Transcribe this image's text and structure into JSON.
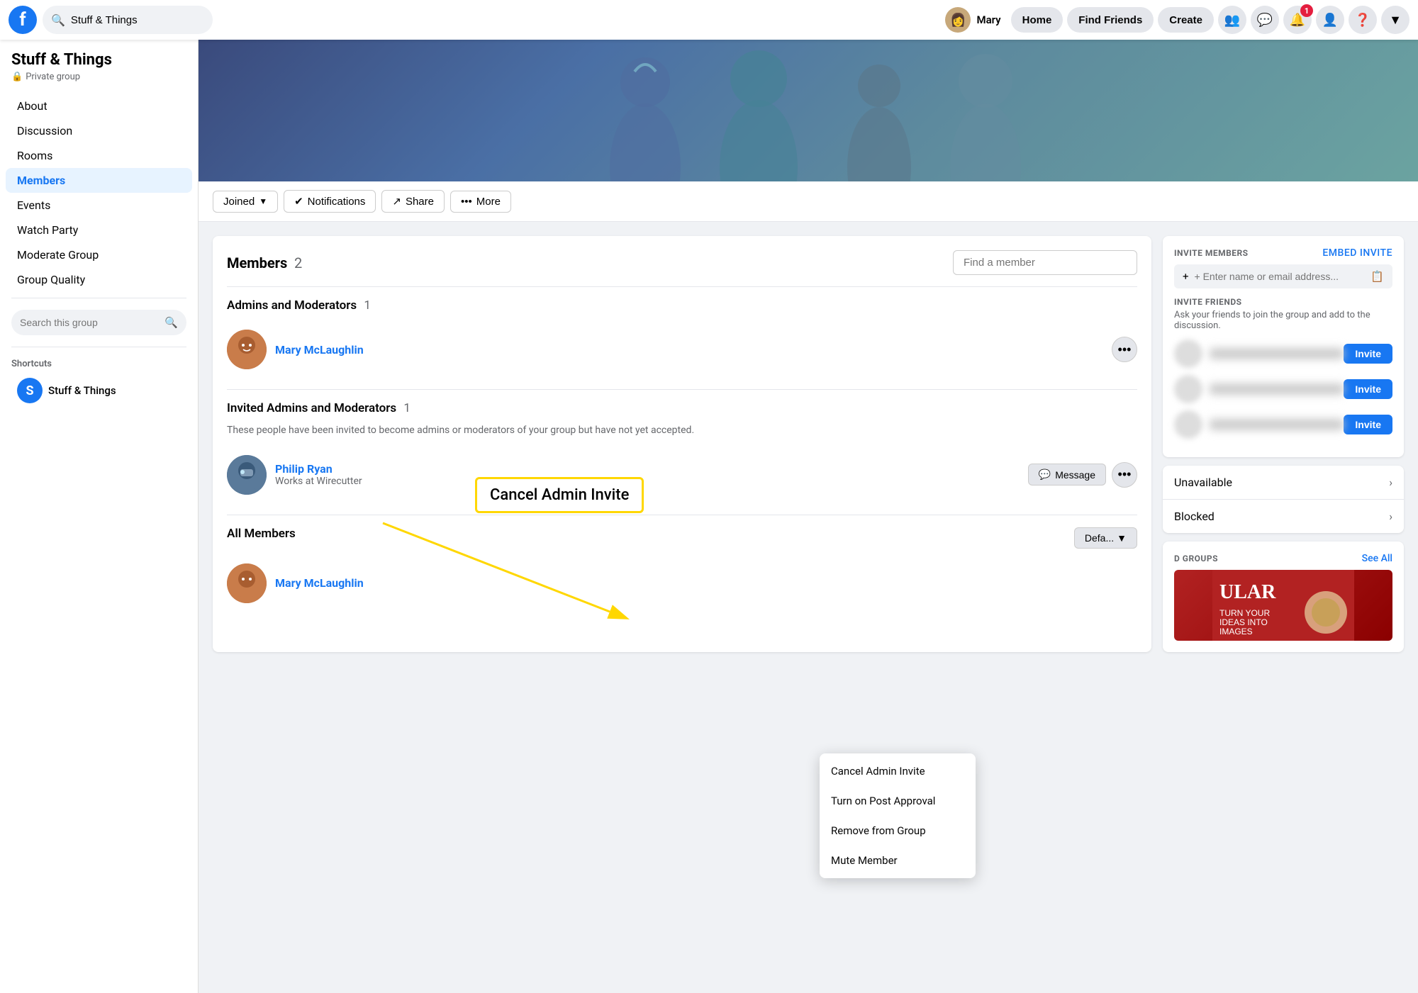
{
  "topnav": {
    "search_placeholder": "Stuff & Things",
    "user_name": "Mary",
    "btn_home": "Home",
    "btn_find_friends": "Find Friends",
    "btn_create": "Create",
    "notif_count": "1"
  },
  "sidebar": {
    "group_name": "Stuff & Things",
    "group_type": "Private group",
    "nav_items": [
      {
        "label": "About",
        "active": false
      },
      {
        "label": "Discussion",
        "active": false
      },
      {
        "label": "Rooms",
        "active": false
      },
      {
        "label": "Members",
        "active": true
      },
      {
        "label": "Events",
        "active": false
      },
      {
        "label": "Watch Party",
        "active": false
      },
      {
        "label": "Moderate Group",
        "active": false
      },
      {
        "label": "Group Quality",
        "active": false
      }
    ],
    "search_placeholder": "Search this group",
    "shortcuts_title": "Shortcuts",
    "shortcut_label": "Stuff & Things"
  },
  "action_bar": {
    "joined_label": "Joined",
    "notifications_label": "Notifications",
    "share_label": "Share",
    "more_label": "More"
  },
  "members_panel": {
    "title": "Members",
    "count": "2",
    "find_placeholder": "Find a member",
    "admins_section": "Admins and Moderators",
    "admins_count": "1",
    "admin_name": "Mary McLaughlin",
    "invited_section": "Invited Admins and Moderators",
    "invited_count": "1",
    "invited_desc": "These people have been invited to become admins or moderators of your group but have not yet accepted.",
    "invited_name": "Philip Ryan",
    "invited_sub": "Works at Wirecutter",
    "all_members_title": "All Members",
    "default_btn": "Defa...",
    "all_member_name": "Mary McLaughlin",
    "msg_btn": "Message"
  },
  "cancel_label": "Cancel Admin Invite",
  "dropdown": {
    "items": [
      "Cancel Admin Invite",
      "Turn on Post Approval",
      "Remove from Group",
      "Mute Member"
    ]
  },
  "right_panel": {
    "invite_title": "INVITE MEMBERS",
    "embed_invite": "Embed Invite",
    "invite_input_placeholder": "+ Enter name or email address...",
    "friends_title": "INVITE FRIENDS",
    "friends_desc": "Ask your friends to join the group and add to the discussion.",
    "invite_btn": "Invite",
    "unavailable_label": "Unavailable",
    "blocked_label": "Blocked",
    "related_title": "D GROUPS",
    "see_all": "See All"
  }
}
